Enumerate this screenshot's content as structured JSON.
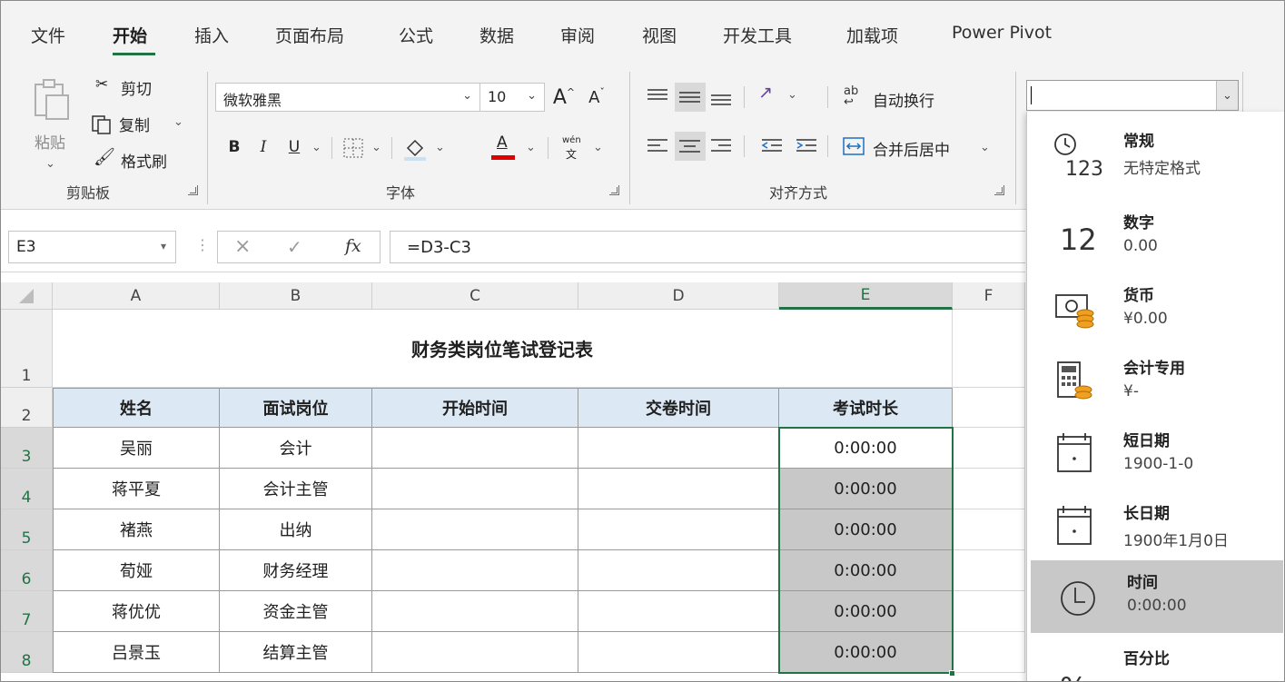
{
  "menu": {
    "tabs": [
      {
        "label": "文件"
      },
      {
        "label": "开始",
        "active": true
      },
      {
        "label": "插入"
      },
      {
        "label": "页面布局"
      },
      {
        "label": "公式"
      },
      {
        "label": "数据"
      },
      {
        "label": "审阅"
      },
      {
        "label": "视图"
      },
      {
        "label": "开发工具"
      },
      {
        "label": "加载项"
      },
      {
        "label": "Power Pivot"
      }
    ]
  },
  "ribbon": {
    "clipboard": {
      "paste_label": "粘贴",
      "cut_label": "剪切",
      "copy_label": "复制",
      "format_painter_label": "格式刷",
      "group_label": "剪贴板"
    },
    "font": {
      "font_name": "微软雅黑",
      "font_size": "10",
      "grow_label": "A",
      "shrink_label": "A",
      "bold_label": "B",
      "italic_label": "I",
      "underline_label": "U",
      "font_color_label": "A",
      "phonetic_top": "wén",
      "phonetic_bottom": "文",
      "group_label": "字体"
    },
    "alignment": {
      "wrap_text_label": "自动换行",
      "merge_center_label": "合并后居中",
      "group_label": "对齐方式"
    },
    "number_format": {
      "value": ""
    }
  },
  "formula_bar": {
    "name_box": "E3",
    "fx_label": "fx",
    "formula": "=D3-C3"
  },
  "sheet": {
    "columns": [
      "A",
      "B",
      "C",
      "D",
      "E",
      "F"
    ],
    "rows": [
      "1",
      "2",
      "3",
      "4",
      "5",
      "6",
      "7",
      "8"
    ],
    "title": "财务类岗位笔试登记表",
    "headers": [
      "姓名",
      "面试岗位",
      "开始时间",
      "交卷时间",
      "考试时长"
    ],
    "data": [
      {
        "name": "吴丽",
        "position": "会计",
        "start": "",
        "end": "",
        "duration": "0:00:00"
      },
      {
        "name": "蒋平夏",
        "position": "会计主管",
        "start": "",
        "end": "",
        "duration": "0:00:00"
      },
      {
        "name": "褚燕",
        "position": "出纳",
        "start": "",
        "end": "",
        "duration": "0:00:00"
      },
      {
        "name": "荀娅",
        "position": "财务经理",
        "start": "",
        "end": "",
        "duration": "0:00:00"
      },
      {
        "name": "蒋优优",
        "position": "资金主管",
        "start": "",
        "end": "",
        "duration": "0:00:00"
      },
      {
        "name": "吕景玉",
        "position": "结算主管",
        "start": "",
        "end": "",
        "duration": "0:00:00"
      }
    ],
    "selected_cell": "E3"
  },
  "format_dropdown": {
    "items": [
      {
        "name": "常规",
        "sample": "无特定格式",
        "icon": "general-clock-123-icon",
        "icon_text": "123"
      },
      {
        "name": "数字",
        "sample": "0.00",
        "icon": "number-12-icon",
        "icon_text": "12"
      },
      {
        "name": "货币",
        "sample": "¥0.00",
        "icon": "currency-icon"
      },
      {
        "name": "会计专用",
        "sample": "¥-",
        "icon": "accounting-calculator-icon"
      },
      {
        "name": "短日期",
        "sample": "1900-1-0",
        "icon": "short-date-calendar-icon"
      },
      {
        "name": "长日期",
        "sample": "1900年1月0日",
        "icon": "long-date-calendar-icon"
      },
      {
        "name": "时间",
        "sample": "0:00:00",
        "icon": "time-clock-icon",
        "selected": true
      },
      {
        "name": "百分比",
        "sample": "",
        "icon": "percent-icon",
        "icon_text": "%"
      }
    ]
  },
  "colors": {
    "accent_green": "#217346",
    "header_fill": "#dce9f5",
    "duration_fill": "#c8c8c8",
    "font_color_bar": "#e00000",
    "fill_color_bar": "#c9e1f5"
  }
}
